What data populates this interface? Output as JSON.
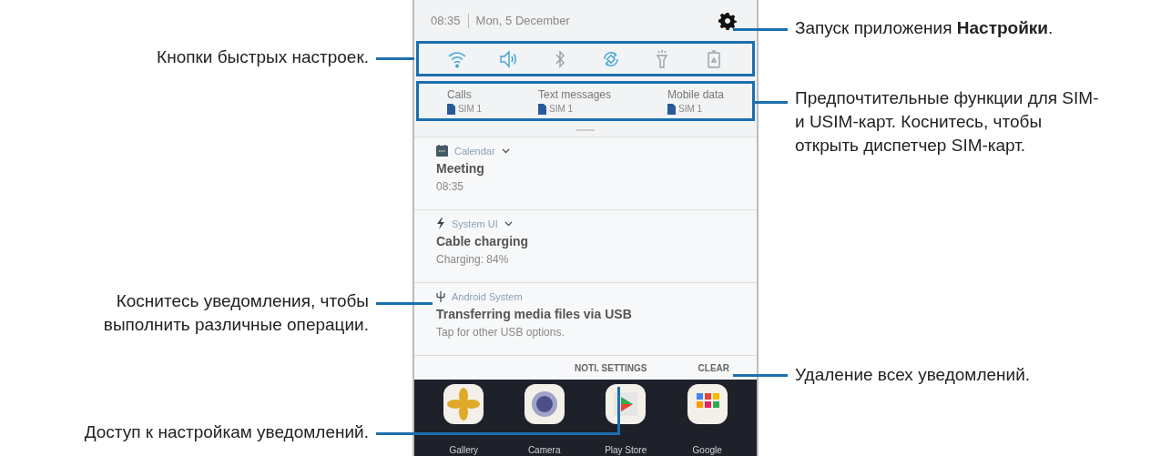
{
  "phone": {
    "status": {
      "time": "08:35",
      "date": "Mon, 5 December"
    },
    "quick_settings": [
      {
        "kind": "wifi",
        "on": true
      },
      {
        "kind": "sound",
        "on": true
      },
      {
        "kind": "bluetooth",
        "on": false
      },
      {
        "kind": "rotate",
        "on": true
      },
      {
        "kind": "flashlight",
        "on": false
      },
      {
        "kind": "power-saving",
        "on": false
      }
    ],
    "sim_preferences": [
      {
        "label": "Calls",
        "sim": "SIM 1"
      },
      {
        "label": "Text messages",
        "sim": "SIM 1"
      },
      {
        "label": "Mobile data",
        "sim": "SIM 1"
      }
    ],
    "notifications": [
      {
        "kind": "calendar",
        "app": "Calendar",
        "expandable": true,
        "title": "Meeting",
        "text": "08:35"
      },
      {
        "kind": "charging",
        "app": "System UI",
        "expandable": true,
        "title": "Cable charging",
        "text": "Charging: 84%"
      },
      {
        "kind": "usb",
        "app": "Android System",
        "expandable": false,
        "title": "Transferring media files via USB",
        "text": "Tap for other USB options."
      }
    ],
    "actions": [
      "NOTI. SETTINGS",
      "CLEAR"
    ],
    "home_apps": [
      {
        "kind": "flower",
        "label": "Gallery"
      },
      {
        "kind": "camera",
        "label": "Camera"
      },
      {
        "kind": "store",
        "label": "Play Store"
      },
      {
        "kind": "folder",
        "label": "Google"
      }
    ]
  },
  "callouts": {
    "left": [
      "Кнопки быстрых настроек.",
      "Коснитесь уведомления, чтобы выполнить различные операции.",
      "Доступ к настройкам уведомлений."
    ],
    "right": [
      "Запуск приложения **Настройки**.",
      "Предпочтительные функции для SIM- и USIM-карт. Коснитесь, чтобы открыть диспетчер SIM-карт.",
      "Удаление всех уведомлений."
    ]
  }
}
